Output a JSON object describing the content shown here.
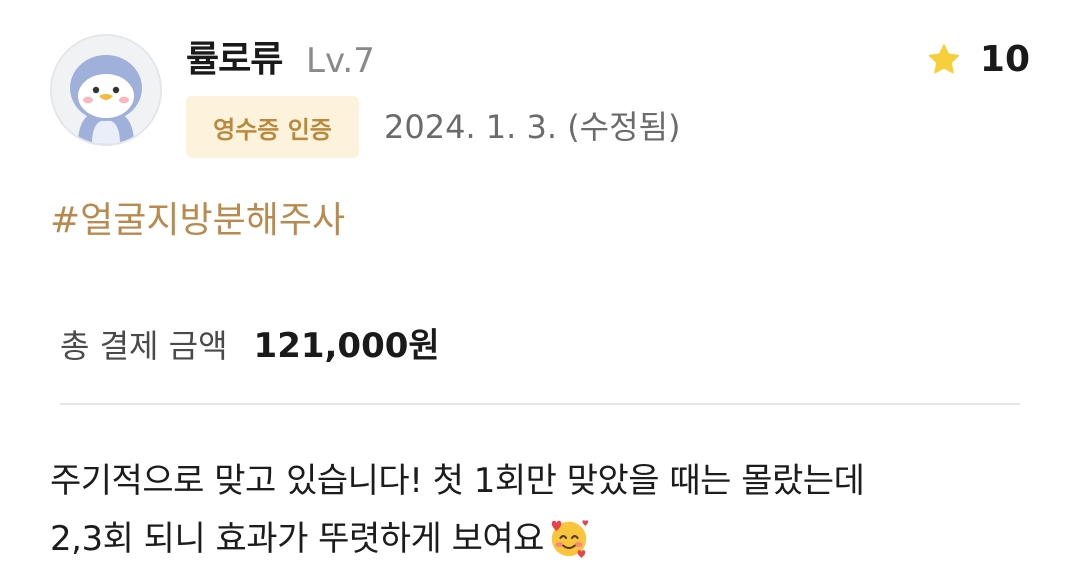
{
  "review": {
    "username": "률로류",
    "level": "Lv.7",
    "rating": "10",
    "badge": "영수증 인증",
    "date": "2024. 1. 3. (수정됨)",
    "hashtag": "#얼굴지방분해주사",
    "payment": {
      "label": "총 결제 금액",
      "value": "121,000원"
    },
    "content": {
      "line1": "주기적으로 맞고 있습니다! 첫 1회만 맞았을 때는 몰랐는데",
      "line2": "2,3회 되니 효과가 뚜렷하게 보여요"
    }
  },
  "icons": {
    "avatar": "penguin-avatar-icon",
    "rating": "star-icon",
    "emoji": "smiling-face-with-hearts-icon"
  },
  "colors": {
    "badge_background": "#fdf3dd",
    "badge_text": "#b98a3e",
    "hashtag": "#b98a4e",
    "star": "#f7cf3b",
    "divider": "#e6e6e6"
  }
}
